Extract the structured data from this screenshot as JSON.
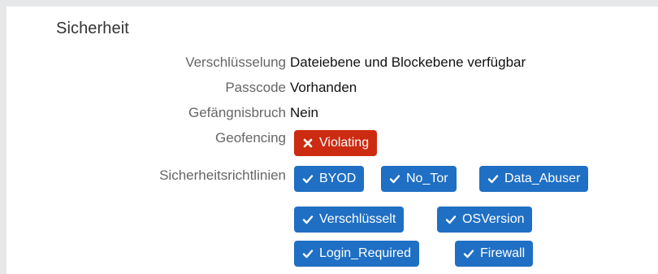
{
  "section": {
    "title": "Sicherheit"
  },
  "fields": {
    "encryption": {
      "label": "Verschlüsselung",
      "value": "Dateiebene und Blockebene verfügbar"
    },
    "passcode": {
      "label": "Passcode",
      "value": "Vorhanden"
    },
    "jailbreak": {
      "label": "Gefängnisbruch",
      "value": "Nein"
    },
    "geofencing": {
      "label": "Geofencing",
      "badge": "Violating",
      "badge_icon": "x-icon",
      "badge_color": "#cc2b11"
    },
    "policies": {
      "label": "Sicherheitsrichtlinien",
      "badge_icon": "check-icon",
      "badge_color": "#1f6fc4",
      "items": [
        "BYOD",
        "No_Tor",
        "Data_Abuser",
        "Verschlüsselt",
        "OSVersion",
        "Login_Required",
        "Firewall"
      ]
    }
  }
}
